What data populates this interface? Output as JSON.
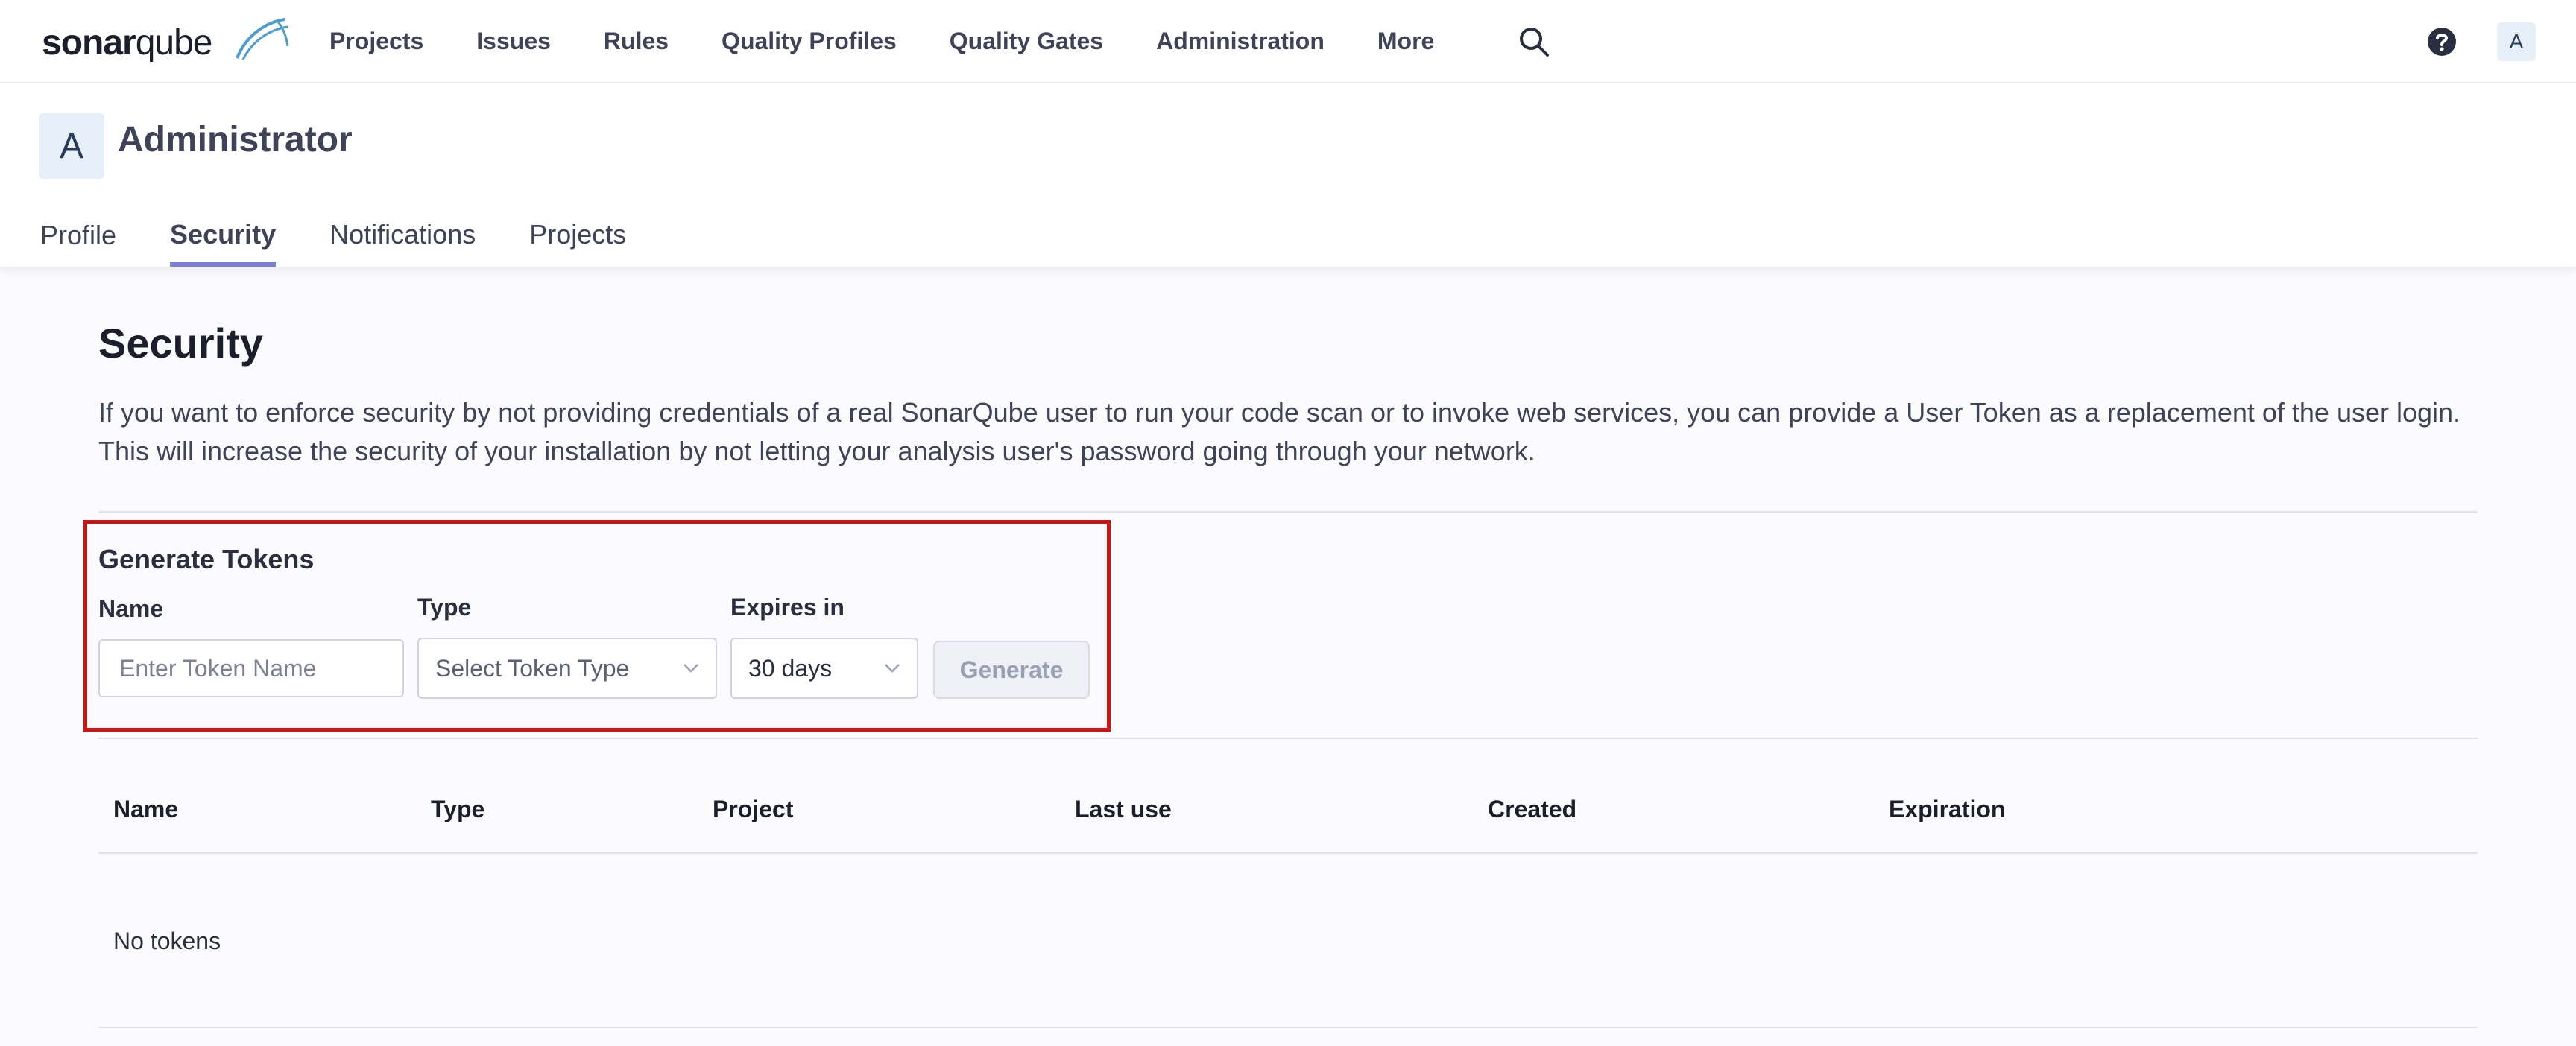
{
  "topbar": {
    "logo_bold": "sonar",
    "logo_light": "qube",
    "nav": [
      "Projects",
      "Issues",
      "Rules",
      "Quality Profiles",
      "Quality Gates",
      "Administration",
      "More"
    ],
    "user_initial": "A"
  },
  "account": {
    "initial": "A",
    "name": "Administrator",
    "tabs": [
      "Profile",
      "Security",
      "Notifications",
      "Projects"
    ],
    "active_tab": "Security"
  },
  "security": {
    "title": "Security",
    "description": "If you want to enforce security by not providing credentials of a real SonarQube user to run your code scan or to invoke web services, you can provide a User Token as a replacement of the user login. This will increase the security of your installation by not letting your analysis user's password going through your network."
  },
  "generate": {
    "title": "Generate Tokens",
    "name_label": "Name",
    "name_placeholder": "Enter Token Name",
    "type_label": "Type",
    "type_placeholder": "Select Token Type",
    "expires_label": "Expires in",
    "expires_value": "30 days",
    "button": "Generate"
  },
  "tokens_table": {
    "columns": [
      "Name",
      "Type",
      "Project",
      "Last use",
      "Created",
      "Expiration"
    ],
    "empty_text": "No tokens"
  },
  "colors": {
    "accent": "#7b7fd6",
    "highlight_border": "#cc1414"
  }
}
